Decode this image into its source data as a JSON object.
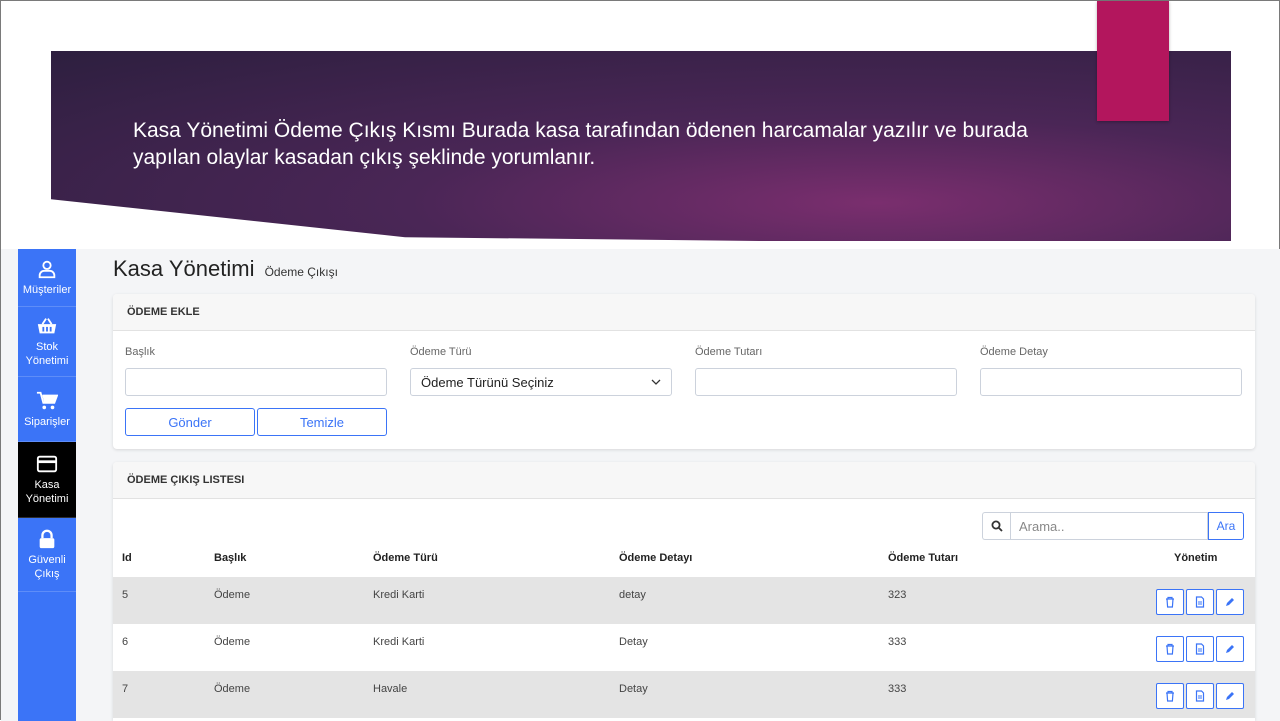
{
  "slide": {
    "text": "Kasa Yönetimi Ödeme Çıkış Kısmı Burada kasa tarafından ödenen harcamalar yazılır ve burada yapılan olaylar kasadan çıkış şeklinde yorumlanır.",
    "accent_color": "#b3165d"
  },
  "sidebar": {
    "items": [
      {
        "label": "Müşteriler",
        "icon": "user-icon"
      },
      {
        "label": "Stok Yönetimi",
        "icon": "basket-icon"
      },
      {
        "label": "Siparişler",
        "icon": "cart-icon"
      },
      {
        "label": "Kasa Yönetimi",
        "icon": "cash-register-icon",
        "active": true
      },
      {
        "label": "Güvenli Çıkış",
        "icon": "lock-icon"
      }
    ]
  },
  "page": {
    "title": "Kasa Yönetimi",
    "subtitle": "Ödeme Çıkışı"
  },
  "form_card": {
    "header": "ÖDEME EKLE",
    "labels": {
      "title": "Başlık",
      "type": "Ödeme Türü",
      "amount": "Ödeme Tutarı",
      "detail": "Ödeme Detay"
    },
    "select_value": "Ödeme Türünü Seçiniz",
    "submit_label": "Gönder",
    "clear_label": "Temizle"
  },
  "list_card": {
    "header": "ÖDEME ÇIKIŞ LISTESI",
    "search_placeholder": "Arama..",
    "search_button": "Ara",
    "columns": [
      "Id",
      "Başlık",
      "Ödeme Türü",
      "Ödeme Detayı",
      "Ödeme Tutarı",
      "Yönetim"
    ],
    "rows": [
      {
        "id": "5",
        "title": "Ödeme",
        "type": "Kredi Karti",
        "detail": "detay",
        "amount": "323"
      },
      {
        "id": "6",
        "title": "Ödeme",
        "type": "Kredi Karti",
        "detail": "Detay",
        "amount": "333"
      },
      {
        "id": "7",
        "title": "Ödeme",
        "type": "Havale",
        "detail": "Detay",
        "amount": "333"
      }
    ],
    "row_actions": [
      "trash-icon",
      "document-icon",
      "pencil-icon"
    ]
  },
  "colors": {
    "primary": "#3b74f7",
    "sidebar_active": "#000000"
  }
}
